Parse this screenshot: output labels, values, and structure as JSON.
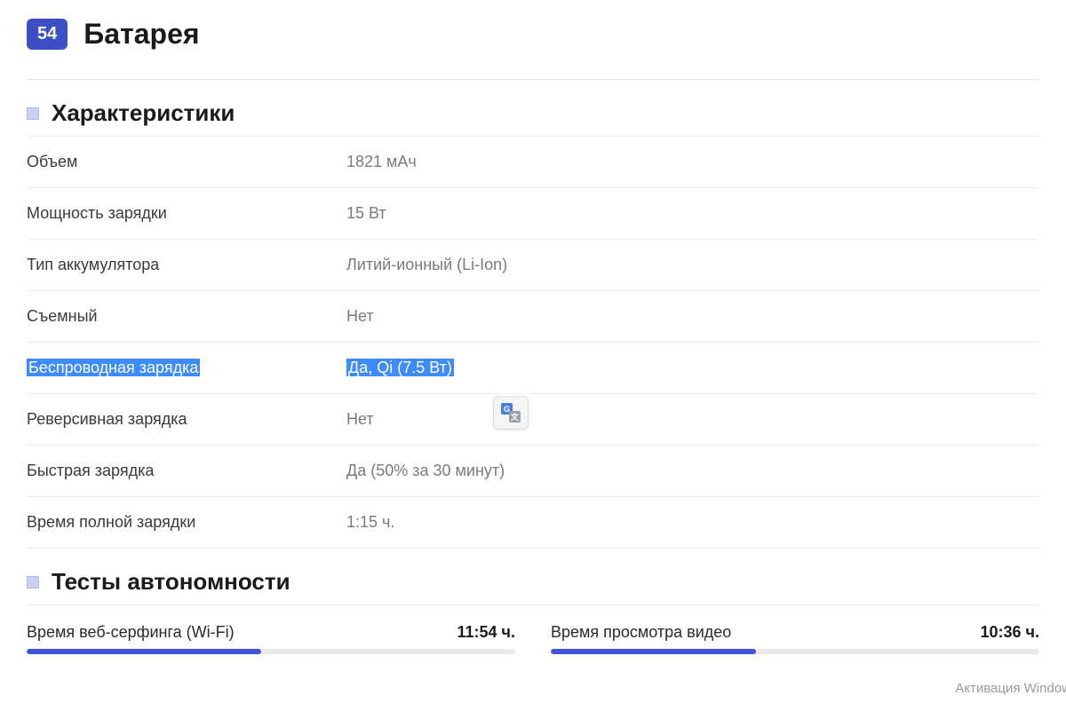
{
  "header": {
    "score": "54",
    "title": "Батарея"
  },
  "section1": {
    "title": "Характеристики",
    "rows": [
      {
        "label": "Объем",
        "value": "1821 мАч"
      },
      {
        "label": "Мощность зарядки",
        "value": "15 Вт"
      },
      {
        "label": "Тип аккумулятора",
        "value": "Литий-ионный (Li-Ion)"
      },
      {
        "label": "Съемный",
        "value": "Нет"
      },
      {
        "label": "Беспроводная зарядка",
        "value": "Да, Qi (7.5 Вт)",
        "highlighted": true
      },
      {
        "label": "Реверсивная зарядка",
        "value": "Нет"
      },
      {
        "label": "Быстрая зарядка",
        "value": "Да (50% за 30 минут)"
      },
      {
        "label": "Время полной зарядки",
        "value": "1:15 ч."
      }
    ]
  },
  "section2": {
    "title": "Тесты автономности",
    "tests": [
      {
        "name": "Время веб-серфинга (Wi-Fi)",
        "value": "11:54 ч.",
        "pct": 48
      },
      {
        "name": "Время просмотра видео",
        "value": "10:36 ч.",
        "pct": 42
      }
    ]
  },
  "watermark": "Активация Window"
}
